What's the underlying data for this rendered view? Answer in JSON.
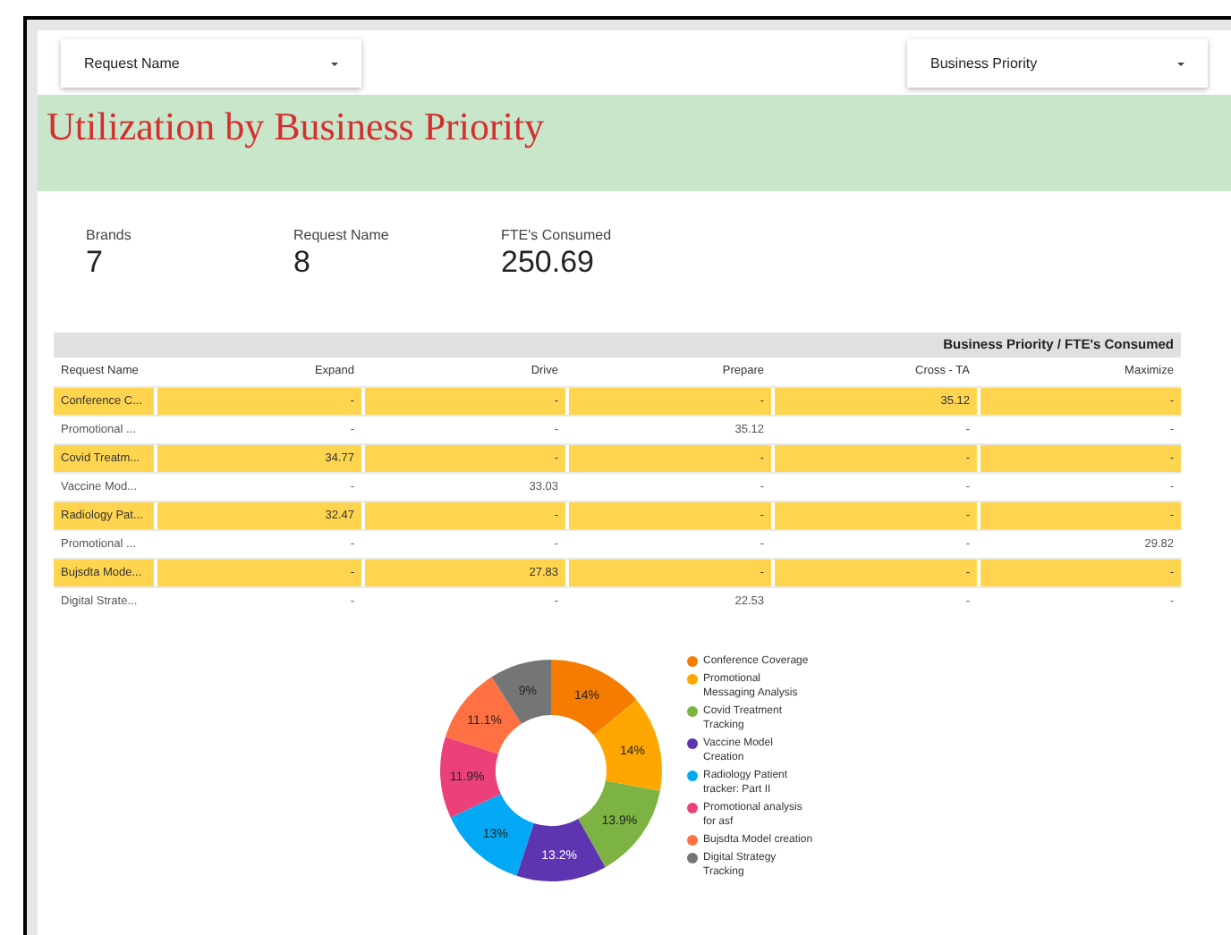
{
  "filters": [
    {
      "label": "Request Name"
    },
    {
      "label": "Business Priority"
    }
  ],
  "banner": {
    "title": "Utilization by Business Priority"
  },
  "scorecards": [
    {
      "label": "Brands",
      "value": "7"
    },
    {
      "label": "Request Name",
      "value": "8"
    },
    {
      "label": "FTE's Consumed",
      "value": "250.69"
    }
  ],
  "table": {
    "group_header": "Business Priority / FTE's Consumed",
    "columns": [
      "Request Name",
      "Expand",
      "Drive",
      "Prepare",
      "Cross - TA",
      "Maximize"
    ],
    "rows": [
      {
        "highlighted": true,
        "cells": [
          "Conference C...",
          "-",
          "-",
          "-",
          "35.12",
          "-"
        ]
      },
      {
        "highlighted": false,
        "cells": [
          "Promotional ...",
          "-",
          "-",
          "35.12",
          "-",
          "-"
        ]
      },
      {
        "highlighted": true,
        "cells": [
          "Covid Treatm...",
          "34.77",
          "-",
          "-",
          "-",
          "-"
        ]
      },
      {
        "highlighted": false,
        "cells": [
          "Vaccine Mod...",
          "-",
          "33.03",
          "-",
          "-",
          "-"
        ]
      },
      {
        "highlighted": true,
        "cells": [
          "Radiology Pat...",
          "32.47",
          "-",
          "-",
          "-",
          "-"
        ]
      },
      {
        "highlighted": false,
        "cells": [
          "Promotional ...",
          "-",
          "-",
          "-",
          "-",
          "29.82"
        ]
      },
      {
        "highlighted": true,
        "cells": [
          "Bujsdta Mode...",
          "-",
          "27.83",
          "-",
          "-",
          "-"
        ]
      },
      {
        "highlighted": false,
        "cells": [
          "Digital Strate...",
          "-",
          "-",
          "22.53",
          "-",
          "-"
        ]
      }
    ]
  },
  "chart_data": {
    "type": "donut",
    "legend": "right",
    "categories": [
      "Conference Coverage",
      "Promotional Messaging Analysis",
      "Covid Treatment Tracking",
      "Vaccine Model Creation",
      "Radiology Patient tracker: Part II",
      "Promotional analysis for asf",
      "Bujsdta Model creation",
      "Digital Strategy Tracking"
    ],
    "colors": [
      "#f57c00",
      "#ffa600",
      "#7cb342",
      "#5e35b1",
      "#03a9f4",
      "#ec407a",
      "#ff7043",
      "#757575"
    ],
    "values": [
      14,
      14,
      13.9,
      13.2,
      13,
      11.9,
      11.1,
      9
    ],
    "value_labels": [
      "14%",
      "14%",
      "13.9%",
      "13.2%",
      "13%",
      "11.9%",
      "11.1%",
      "9%"
    ]
  }
}
